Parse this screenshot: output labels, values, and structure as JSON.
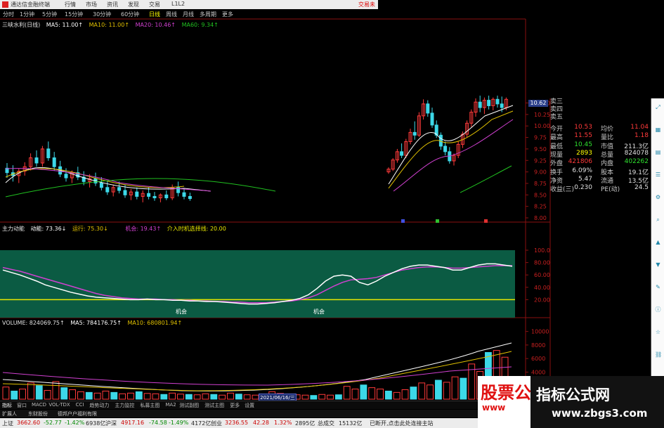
{
  "titlebar": {
    "app_name": "通达信金融终端",
    "menus": [
      "行情",
      "市场",
      "资讯",
      "发现",
      "交易",
      "L1L2"
    ],
    "login": "交易未"
  },
  "period_tabs": [
    "分时",
    "1分钟",
    "5分钟",
    "15分钟",
    "30分钟",
    "60分钟",
    "日线",
    "周线",
    "月线",
    "多周期",
    "更多"
  ],
  "active_period": "日线",
  "ma_legend": {
    "stock_name": "三峡水利(日线)",
    "ma5": "MA5: 11.00↑",
    "ma10": "MA10: 11.00↑",
    "ma20": "MA20: 10.46↑",
    "ma60": "MA60: 9.34↑"
  },
  "price_badge": "10.62",
  "price_axis": [
    "10.50",
    "10.25",
    "10.00",
    "9.75",
    "9.50",
    "9.25",
    "9.00",
    "8.75",
    "8.50",
    "8.25",
    "8.00"
  ],
  "candle_chart": {
    "candles": [
      [
        9.48,
        9.55,
        9.35,
        9.42
      ],
      [
        9.42,
        9.52,
        9.3,
        9.38
      ],
      [
        9.38,
        9.48,
        9.28,
        9.44
      ],
      [
        9.44,
        9.56,
        9.38,
        9.5
      ],
      [
        9.5,
        9.68,
        9.45,
        9.62
      ],
      [
        9.62,
        9.72,
        9.5,
        9.55
      ],
      [
        9.55,
        9.78,
        9.5,
        9.74
      ],
      [
        9.74,
        9.84,
        9.58,
        9.62
      ],
      [
        9.62,
        9.7,
        9.45,
        9.5
      ],
      [
        9.5,
        9.58,
        9.36,
        9.4
      ],
      [
        9.4,
        9.48,
        9.3,
        9.35
      ],
      [
        9.35,
        9.45,
        9.28,
        9.42
      ],
      [
        9.42,
        9.5,
        9.32,
        9.36
      ],
      [
        9.36,
        9.44,
        9.25,
        9.3
      ],
      [
        9.3,
        9.4,
        9.22,
        9.34
      ],
      [
        9.34,
        9.42,
        9.24,
        9.28
      ],
      [
        9.28,
        9.36,
        9.18,
        9.22
      ],
      [
        9.22,
        9.3,
        9.12,
        9.16
      ],
      [
        9.16,
        9.26,
        9.1,
        9.22
      ],
      [
        9.22,
        9.3,
        9.14,
        9.18
      ],
      [
        9.18,
        9.26,
        9.08,
        9.12
      ],
      [
        9.12,
        9.2,
        9.05,
        9.16
      ],
      [
        9.16,
        9.22,
        9.06,
        9.1
      ],
      [
        9.1,
        9.18,
        9.02,
        9.14
      ],
      [
        9.14,
        9.22,
        9.06,
        9.1
      ],
      [
        9.1,
        9.16,
        9.04,
        9.08
      ],
      [
        9.08,
        9.14,
        9.02,
        9.12
      ],
      [
        9.12,
        9.18,
        9.05,
        9.08
      ],
      [
        9.08,
        9.26,
        9.05,
        9.22
      ],
      [
        9.22,
        9.3,
        9.1,
        9.15
      ],
      [
        9.15,
        9.2,
        9.06,
        9.1
      ],
      [
        9.1,
        9.15,
        9.04,
        9.07
      ]
    ],
    "right_candles": [
      [
        9.0,
        9.1,
        8.96,
        9.06
      ],
      [
        9.06,
        9.3,
        9.02,
        9.26
      ],
      [
        9.26,
        9.5,
        9.2,
        9.44
      ],
      [
        9.44,
        9.62,
        9.3,
        9.36
      ],
      [
        9.36,
        9.72,
        9.3,
        9.66
      ],
      [
        9.66,
        9.94,
        9.6,
        9.86
      ],
      [
        9.86,
        10.1,
        9.7,
        9.8
      ],
      [
        9.8,
        10.3,
        9.76,
        10.22
      ],
      [
        10.22,
        10.58,
        10.14,
        10.48
      ],
      [
        10.48,
        10.56,
        10.2,
        10.28
      ],
      [
        10.28,
        10.4,
        9.96,
        10.02
      ],
      [
        10.02,
        10.12,
        9.74,
        9.8
      ],
      [
        9.8,
        9.86,
        9.48,
        9.56
      ],
      [
        9.56,
        9.66,
        9.36,
        9.44
      ],
      [
        9.44,
        9.54,
        9.18,
        9.24
      ],
      [
        9.24,
        9.4,
        9.14,
        9.36
      ],
      [
        9.36,
        9.66,
        9.3,
        9.6
      ],
      [
        9.6,
        9.88,
        9.52,
        9.82
      ],
      [
        9.82,
        10.12,
        9.76,
        10.06
      ],
      [
        10.06,
        10.36,
        9.98,
        10.3
      ],
      [
        10.3,
        10.6,
        10.2,
        10.52
      ],
      [
        10.52,
        10.66,
        10.3,
        10.4
      ],
      [
        10.4,
        10.62,
        10.26,
        10.56
      ],
      [
        10.56,
        10.66,
        10.36,
        10.44
      ],
      [
        10.44,
        10.62,
        10.34,
        10.58
      ],
      [
        10.58,
        10.66,
        10.4,
        10.48
      ],
      [
        10.48,
        10.64,
        10.3,
        10.4
      ],
      [
        10.4,
        10.62,
        10.34,
        10.58
      ]
    ]
  },
  "indicator": {
    "name": "主力动能",
    "dong_neng": "动能: 73.36↓",
    "yun_xing": "运行: 75.30↓",
    "ji_hui": "机会: 19.43↑",
    "threshold_label": "介入时机选择线: 20.00",
    "opportunity_label": "机会",
    "axis": [
      "100.0",
      "80.00",
      "60.00",
      "40.00",
      "20.00"
    ],
    "white_line": [
      68,
      64,
      60,
      55,
      50,
      44,
      40,
      36,
      32,
      29,
      26,
      24,
      23,
      22,
      21,
      20,
      20,
      21,
      20,
      20,
      19,
      19,
      18,
      18,
      17,
      17,
      16,
      15,
      14,
      13,
      13,
      14,
      15,
      17,
      19,
      22,
      28,
      38,
      50,
      58,
      60,
      58,
      48,
      44,
      50,
      58,
      64,
      70,
      74,
      76,
      76,
      74,
      72,
      68,
      68,
      72,
      76,
      78,
      78,
      76,
      74
    ],
    "magenta_line": [
      72,
      69,
      66,
      62,
      58,
      54,
      50,
      46,
      42,
      38,
      34,
      30,
      27,
      25,
      23,
      22,
      21,
      21,
      21,
      20,
      20,
      19,
      19,
      18,
      18,
      17,
      17,
      16,
      16,
      15,
      15,
      15,
      16,
      17,
      18,
      20,
      23,
      28,
      35,
      42,
      48,
      52,
      53,
      54,
      56,
      60,
      64,
      68,
      70,
      72,
      73,
      73,
      72,
      71,
      71,
      72,
      73,
      74,
      75,
      75,
      75
    ],
    "threshold": 20
  },
  "volume": {
    "legend": "VOLUME: 824069.75↑",
    "ma5": "MA5: 784176.75↑",
    "ma10": "MA10: 680801.94↑",
    "axis": [
      "10000",
      "8000",
      "6000",
      "4000",
      "2000"
    ],
    "values": [
      1800,
      1200,
      1500,
      2400,
      2000,
      1300,
      2600,
      1700,
      1400,
      1100,
      1000,
      900,
      1200,
      1000,
      800,
      900,
      1100,
      850,
      800,
      700,
      900,
      750,
      700,
      650,
      800,
      700,
      600,
      900,
      750,
      650,
      600,
      700,
      1100,
      850,
      700,
      650,
      600,
      550,
      700,
      600,
      650,
      1900,
      1500,
      2100,
      1700,
      1500,
      1200,
      1000,
      1400,
      1800,
      2400,
      2100,
      2800,
      2500,
      3300,
      3100,
      5200,
      4100,
      6900,
      7200,
      6200
    ]
  },
  "quote": {
    "sell_rows": [
      "卖三",
      "卖四",
      "卖五"
    ],
    "rows": [
      [
        "今开",
        "10.53",
        "均价",
        "11.04"
      ],
      [
        "最高",
        "11.55",
        "量比",
        "1.18"
      ],
      [
        "最低",
        "10.45",
        "市值",
        "211.3亿"
      ],
      [
        "现量",
        "2893",
        "总量",
        "824078"
      ],
      [
        "外盘",
        "421806",
        "内盘",
        "402262"
      ],
      [
        "换手",
        "6.09%",
        "股本",
        "19.1亿"
      ],
      [
        "净资",
        "5.47",
        "流通",
        "13.5亿"
      ],
      [
        "收益(三)",
        "0.230",
        "PE(动)",
        "24.5"
      ]
    ],
    "colors": {
      "up": "#ff3a3a",
      "down": "#2ee02e",
      "neutral": "#e0e0e0",
      "amount": "#ffff00"
    }
  },
  "bottom_tabs": [
    "指标",
    "窗口",
    "MACD",
    "VOL-TDX",
    "CCI",
    "趋势动力",
    "主力监控",
    "私募主图",
    "MA2",
    "测试副图",
    "测试主图",
    "更多",
    "设置"
  ],
  "ad_strip": [
    "扩展人",
    "东财股份",
    "德邦户户福利有限"
  ],
  "date_badge": "2021/06/16/三",
  "statusbar": {
    "items": [
      "上证",
      "3662.60",
      "-52.77",
      "-1.42%",
      "6938亿",
      "沪深",
      "4917.16",
      "-74.58",
      "-1.49%",
      "4172亿",
      "创业",
      "3236.55",
      "42.28",
      "1.32%",
      "2895亿",
      "总成交",
      "15132亿",
      "已断开,点击此处连接主站"
    ]
  },
  "watermark": {
    "left_big": "股票公式指标",
    "left_small": "www",
    "right_cn": "指标公式网",
    "right_url": "www.zbgs3.com"
  },
  "toolbar_icons": [
    "expand-icon",
    "chart-icon",
    "grid-icon",
    "list-icon",
    "settings-icon",
    "zoom-icon",
    "arrow-up-icon",
    "arrow-down-icon",
    "tool-icon",
    "info-icon",
    "star-icon",
    "link-icon"
  ],
  "colors": {
    "up": "#ff3a3a",
    "down": "#3cd8e8",
    "ma5": "#ffffff",
    "ma10": "#e0c000",
    "ma20": "#d040d0",
    "ma60": "#20c020",
    "indicator_bg": "#0b5b43",
    "threshold": "#e8e800"
  }
}
